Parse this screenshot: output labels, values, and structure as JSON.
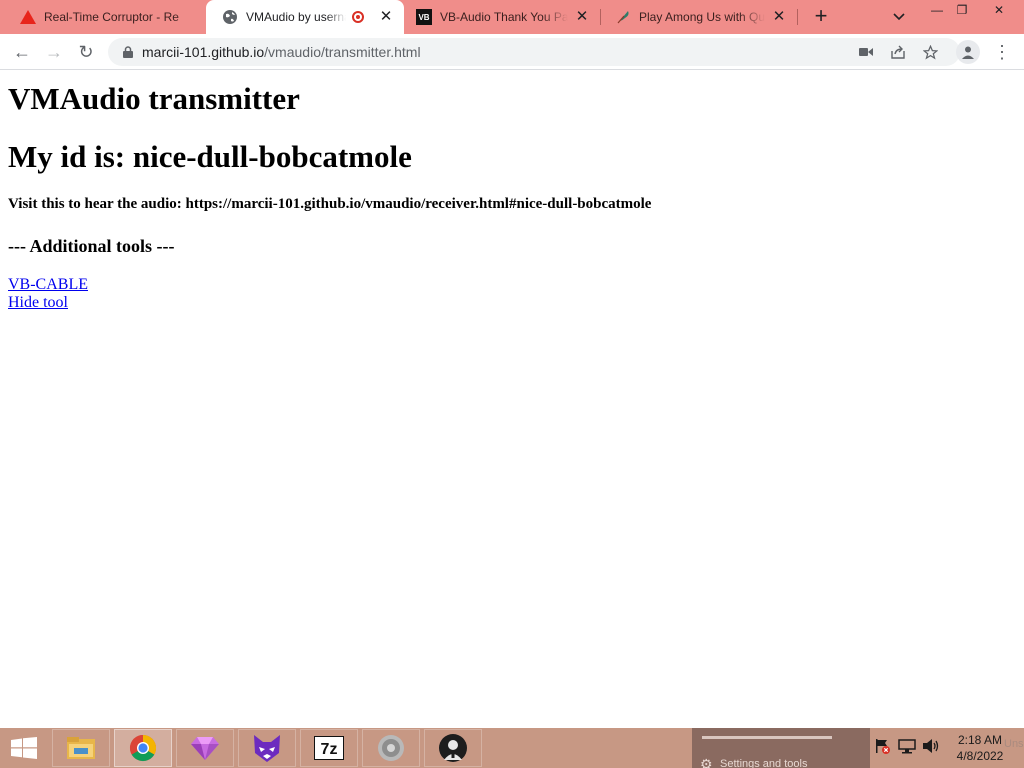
{
  "browser": {
    "tabs": [
      {
        "title": "Real-Time Corruptor - Re",
        "icon": "warning-triangle-icon"
      },
      {
        "title": "VMAudio by usernan",
        "icon": "globe-icon",
        "recording": true
      },
      {
        "title": "VB-Audio Thank You Pag",
        "icon": "vb-logo-icon",
        "logo_text": "VB"
      },
      {
        "title": "Play Among Us with Qui",
        "icon": "feather-icon"
      }
    ],
    "new_tab": "+",
    "tab_search": "⌄",
    "window_controls": {
      "minimize": "—",
      "restore": "❐",
      "close": "✕"
    },
    "nav": {
      "back": "←",
      "forward": "→",
      "reload": "↻"
    },
    "url_host": "marcii-101.github.io",
    "url_path": "/vmaudio/transmitter.html",
    "omnibox_icons": [
      "camera-icon",
      "share-icon",
      "star-icon"
    ],
    "menu": "⋮"
  },
  "page": {
    "title": "VMAudio transmitter",
    "id_line": "My id is: nice-dull-bobcatmole",
    "visit_line": "Visit this to hear the audio: https://marcii-101.github.io/vmaudio/receiver.html#nice-dull-bobcatmole",
    "tools_heading": "--- Additional tools ---",
    "links": [
      "VB-CABLE",
      "Hide tool"
    ]
  },
  "taskbar": {
    "apps": [
      "file-explorer-icon",
      "chrome-icon",
      "gem-icon",
      "cat-mask-icon",
      "7zip-icon",
      "speaker-app-icon",
      "anonymous-icon"
    ],
    "sevenzip_text": "7z",
    "flyout_label": "Settings and tools",
    "time": "2:18 AM",
    "date": "4/8/2022",
    "ghost_text": "Unse"
  },
  "colors": {
    "tabstrip": "#f08d8a",
    "taskbar": "#c79884",
    "link": "#0000ee"
  }
}
